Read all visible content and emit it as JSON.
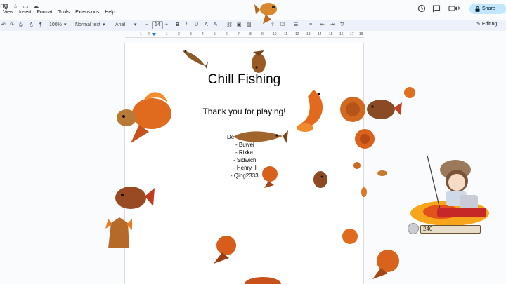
{
  "doc": {
    "title_fragment": "ing"
  },
  "menu": [
    "View",
    "Insert",
    "Format",
    "Tools",
    "Extensions",
    "Help"
  ],
  "toolbar": {
    "zoom": "100%",
    "style": "Normal text",
    "font": "Arial",
    "size": "14",
    "mode": "Editing"
  },
  "share_label": "Share",
  "ruler": [
    "1",
    "2",
    "1",
    "2",
    "3",
    "4",
    "5",
    "6",
    "7",
    "8",
    "9",
    "10",
    "11",
    "12",
    "13",
    "14",
    "15",
    "16",
    "17",
    "18",
    "19"
  ],
  "page": {
    "title": "Chill Fishing",
    "subtitle": "Thank you for playing!",
    "credits_heading": "De",
    "credits": [
      "- Buwei",
      "- Rikka",
      "- Sidwich",
      "- Henry II",
      "- Qing2333"
    ]
  },
  "game_hud": {
    "coins": "240"
  },
  "colors": {
    "accent": "#1a73e8",
    "share_bg": "#c2e7ff",
    "toolbar_bg": "#edf2fa",
    "fish_orange": "#e0661c",
    "fish_brown": "#8b4a1f"
  }
}
